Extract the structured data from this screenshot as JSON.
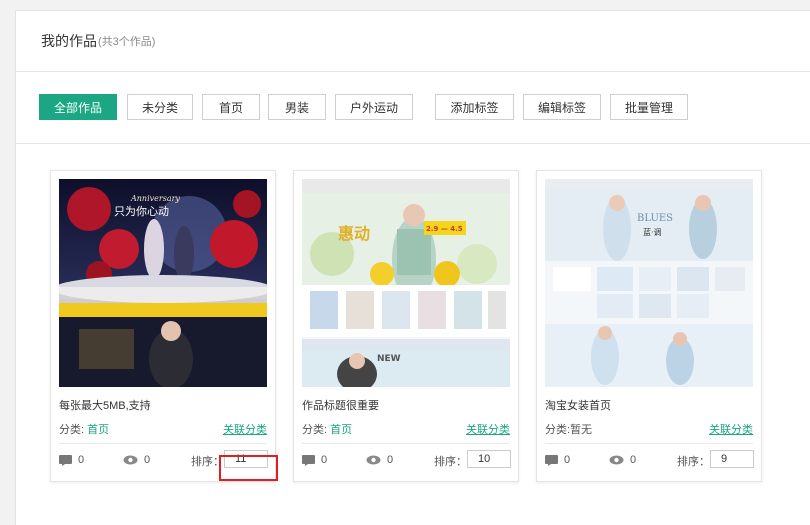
{
  "header": {
    "title": "我的作品",
    "count": "(共3个作品)"
  },
  "filters": [
    {
      "label": "全部作品",
      "active": true
    },
    {
      "label": "未分类",
      "active": false
    },
    {
      "label": "首页",
      "active": false
    },
    {
      "label": "男装",
      "active": false
    },
    {
      "label": "户外运动",
      "active": false
    },
    {
      "label": "添加标签",
      "active": false
    },
    {
      "label": "编辑标签",
      "active": false
    },
    {
      "label": "批量管理",
      "active": false
    }
  ],
  "cards": [
    {
      "title": "每张最大5MB,支持",
      "category_label": "分类:",
      "category_value": "首页",
      "link": "关联分类",
      "likes": "0",
      "views": "0",
      "sort_label": "排序：",
      "sort_value": "11"
    },
    {
      "title": "作品标题很重要",
      "category_label": "分类:",
      "category_value": "首页",
      "link": "关联分类",
      "likes": "0",
      "views": "0",
      "sort_label": "排序：",
      "sort_value": "10"
    },
    {
      "title": "淘宝女装首页",
      "category_label": "分类:",
      "category_value": "暂无",
      "link": "关联分类",
      "likes": "0",
      "views": "0",
      "sort_label": "排序：",
      "sort_value": "9"
    }
  ],
  "thumb_texts": {
    "card1_script": "Anniversary",
    "card1_headline": "只为你心动",
    "card2_banner": "惠动",
    "card2_promo": "2.9 — 4.5",
    "card2_new": "NEW",
    "card3_banner": "BLUES",
    "card3_sub": "蓝·调"
  },
  "colors": {
    "accent": "#1ba784",
    "highlight": "#e02020"
  }
}
